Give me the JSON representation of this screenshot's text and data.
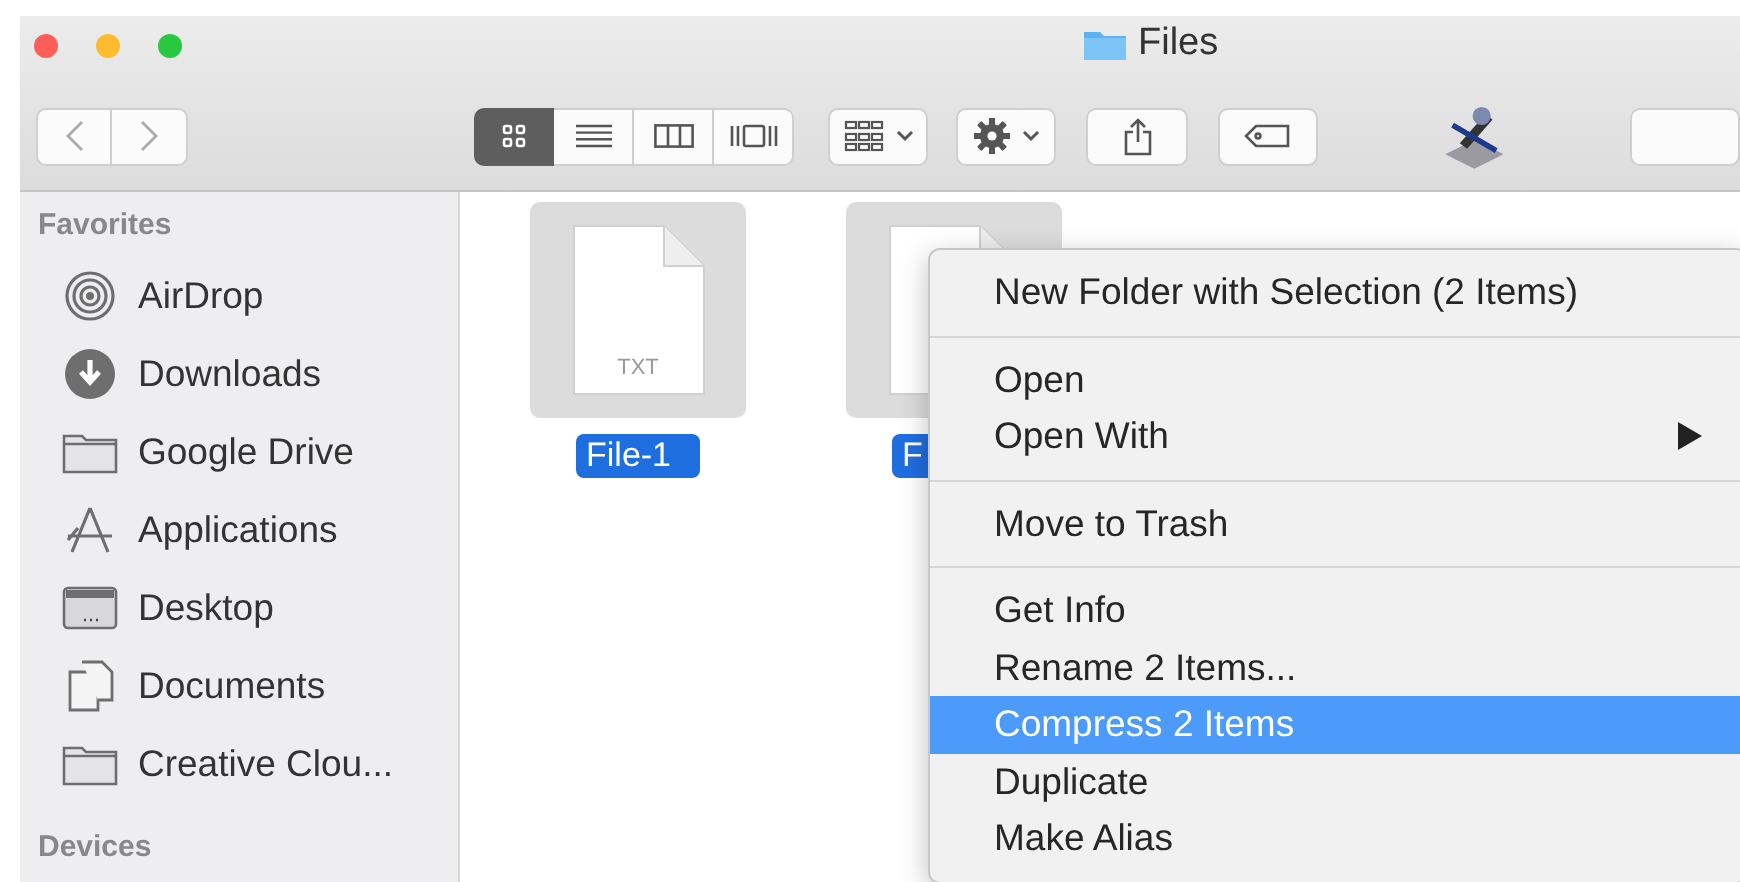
{
  "window": {
    "title": "Files"
  },
  "toolbar": {
    "view_modes": [
      {
        "kind": "icons",
        "selected": true
      },
      {
        "kind": "list",
        "selected": false
      },
      {
        "kind": "columns",
        "selected": false
      },
      {
        "kind": "gallery",
        "selected": false
      }
    ]
  },
  "sidebar": {
    "sections": [
      {
        "title": "Favorites",
        "items": [
          {
            "label": "AirDrop",
            "kind": "airdrop"
          },
          {
            "label": "Downloads",
            "kind": "downloads"
          },
          {
            "label": "Google Drive",
            "kind": "folder"
          },
          {
            "label": "Applications",
            "kind": "apps"
          },
          {
            "label": "Desktop",
            "kind": "desktop"
          },
          {
            "label": "Documents",
            "kind": "documents"
          },
          {
            "label": "Creative Clou...",
            "kind": "folder"
          }
        ]
      },
      {
        "title": "Devices"
      }
    ]
  },
  "files": [
    {
      "label": "File-1",
      "type": "TXT",
      "selected": true
    },
    {
      "label": "F",
      "selected": true
    }
  ],
  "context_menu": {
    "groups": [
      [
        {
          "label": "New Folder with Selection (2 Items)",
          "selected": false,
          "submenu": false
        }
      ],
      [
        {
          "label": "Open",
          "selected": false,
          "submenu": false
        },
        {
          "label": "Open With",
          "selected": false,
          "submenu": true
        }
      ],
      [
        {
          "label": "Move to Trash",
          "selected": false,
          "submenu": false
        }
      ],
      [
        {
          "label": "Get Info",
          "selected": false,
          "submenu": false
        },
        {
          "label": "Rename 2 Items...",
          "selected": false,
          "submenu": false
        },
        {
          "label": "Compress 2 Items",
          "selected": true,
          "submenu": false
        },
        {
          "label": "Duplicate",
          "selected": false,
          "submenu": false
        },
        {
          "label": "Make Alias",
          "selected": false,
          "submenu": false
        }
      ]
    ]
  }
}
